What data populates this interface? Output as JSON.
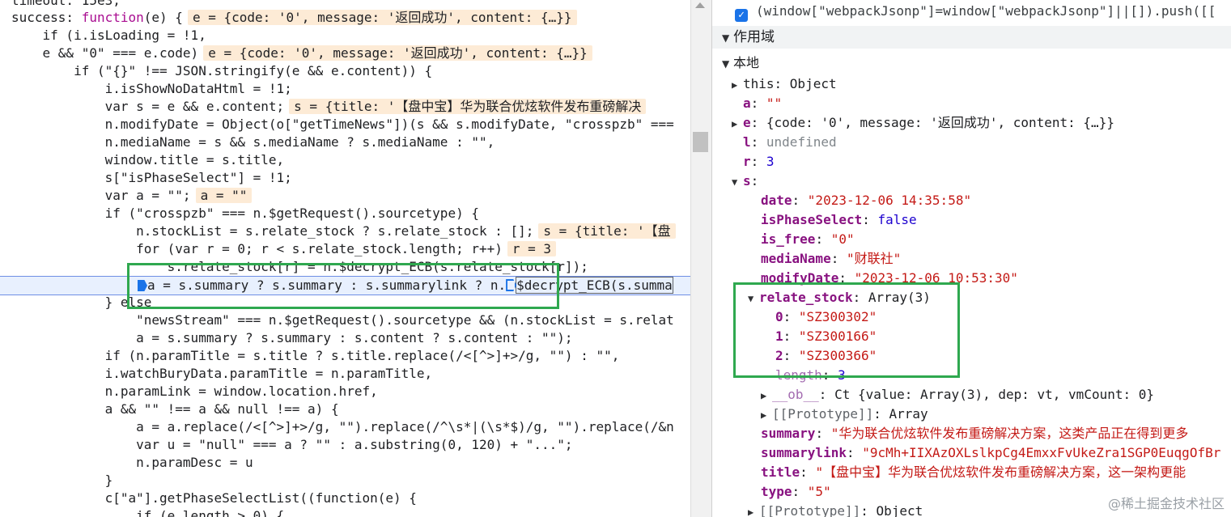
{
  "source": {
    "lines": [
      {
        "id": "l0",
        "text": "timeout: 15e3,"
      },
      {
        "id": "l1",
        "prefix": "success: ",
        "kw": "function",
        "rest": "(e) {",
        "annotation": "e = {code: '0', message: '返回成功', content: {…}}"
      },
      {
        "id": "l2",
        "text": "    if (i.isLoading = !1,"
      },
      {
        "id": "l3",
        "text": "    e && \"0\" === e.code)",
        "annotation": "e = {code: '0', message: '返回成功', content: {…}}"
      },
      {
        "id": "l4",
        "text": "        if (\"{}\" !== JSON.stringify(e && e.content)) {"
      },
      {
        "id": "l5",
        "text": "            i.isShowNoDataHtml = !1;"
      },
      {
        "id": "l6",
        "text": "            var s = e && e.content;",
        "annotation": "s = {title: '【盘中宝】华为联合优炫软件发布重磅解决"
      },
      {
        "id": "l7",
        "text": "            n.modifyDate = Object(o[\"getTimeNews\"])(s && s.modifyDate, \"crosspzb\" ==="
      },
      {
        "id": "l8",
        "text": "            n.mediaName = s && s.mediaName ? s.mediaName : \"\","
      },
      {
        "id": "l9",
        "text": "            window.title = s.title,"
      },
      {
        "id": "l10",
        "text": "            s[\"isPhaseSelect\"] = !1;"
      },
      {
        "id": "l11",
        "text": "            var a = \"\";",
        "annotation": "a = \"\""
      },
      {
        "id": "l12",
        "text": "            if (\"crosspzb\" === n.$getRequest().sourcetype) {"
      },
      {
        "id": "l13",
        "text": "                n.stockList = s.relate_stock ? s.relate_stock : [];",
        "annotation": "s = {title: '【盘"
      },
      {
        "id": "l14",
        "text": "                for (var r = 0; r < s.relate_stock.length; r++)",
        "annotation": "r = 3"
      },
      {
        "id": "l15",
        "text": "                    s.relate_stock[r] = n.$decrypt_ECB(s.relate_stock[r]);"
      },
      {
        "id": "l16",
        "text": "a = s.summary ? s.summary : s.summarylink ? n.",
        "tail": "$decrypt_ECB(s.summa"
      },
      {
        "id": "l17",
        "text": "            } else"
      },
      {
        "id": "l18",
        "text": "                \"newsStream\" === n.$getRequest().sourcetype && (n.stockList = s.relat"
      },
      {
        "id": "l19",
        "text": "                a = s.summary ? s.summary : s.content ? s.content : \"\");"
      },
      {
        "id": "l20",
        "text": "            if (n.paramTitle = s.title ? s.title.replace(/<[^>]+>/g, \"\") : \"\","
      },
      {
        "id": "l21",
        "text": "            i.watchBuryData.paramTitle = n.paramTitle,"
      },
      {
        "id": "l22",
        "text": "            n.paramLink = window.location.href,"
      },
      {
        "id": "l23",
        "text": "            a && \"\" !== a && null !== a) {"
      },
      {
        "id": "l24",
        "text": "                a = a.replace(/<[^>]+>/g, \"\").replace(/^\\s*|(\\s*$)/g, \"\").replace(/&n"
      },
      {
        "id": "l25",
        "text": "                var u = \"null\" === a ? \"\" : a.substring(0, 120) + \"...\";"
      },
      {
        "id": "l26",
        "text": "                n.paramDesc = u"
      },
      {
        "id": "l27",
        "text": "            }"
      },
      {
        "id": "l28",
        "text": "            c[\"a\"].getPhaseSelectList((function(e) {"
      },
      {
        "id": "l29",
        "text": "                if (e.length > 0) {"
      }
    ]
  },
  "scope": {
    "breakpoint_text": "(window[\"webpackJsonp\"]=window[\"webpackJsonp\"]||[]).push([[",
    "section_title": "作用域",
    "local_title": "本地",
    "vars": {
      "this": {
        "key": "this",
        "value": "Object"
      },
      "a": {
        "key": "a",
        "value": "\"\""
      },
      "e": {
        "key": "e",
        "value": "{code: '0', message: '返回成功', content: {…}}"
      },
      "l": {
        "key": "l",
        "value": "undefined"
      },
      "r": {
        "key": "r",
        "value": "3"
      },
      "s": {
        "key": "s",
        "value": ""
      }
    },
    "s_props": {
      "date": {
        "key": "date",
        "value": "\"2023-12-06 14:35:58\""
      },
      "isPhaseSelect": {
        "key": "isPhaseSelect",
        "value": "false"
      },
      "is_free": {
        "key": "is_free",
        "value": "\"0\""
      },
      "mediaName": {
        "key": "mediaName",
        "value": "\"财联社\""
      },
      "modifyDate": {
        "key": "modifyDate",
        "value": "\"2023-12-06 10:53:30\""
      },
      "relate_stock": {
        "key": "relate_stock",
        "value": "Array(3)"
      },
      "rs0": {
        "key": "0",
        "value": "\"SZ300302\""
      },
      "rs1": {
        "key": "1",
        "value": "\"SZ300166\""
      },
      "rs2": {
        "key": "2",
        "value": "\"SZ300366\""
      },
      "length": {
        "key": "length",
        "value": "3"
      },
      "ob": {
        "key": "__ob__",
        "value": "Ct {value: Array(3), dep: vt, vmCount: 0}"
      },
      "proto_arr": {
        "key": "[[Prototype]]",
        "value": "Array"
      },
      "summary": {
        "key": "summary",
        "value": "\"华为联合优炫软件发布重磅解决方案，这类产品正在得到更多"
      },
      "summarylink": {
        "key": "summarylink",
        "value": "\"9cMh+IIXAzOXLslkpCg4EmxxFvUkeZra1SGP0EuqgOfBr"
      },
      "title": {
        "key": "title",
        "value": "\"【盘中宝】华为联合优炫软件发布重磅解决方案，这一架构更能"
      },
      "type": {
        "key": "type",
        "value": "\"5\""
      },
      "proto_obj": {
        "key": "[[Prototype]]",
        "value": "Object"
      }
    }
  },
  "watermark": "@稀土掘金技术社区",
  "colors": {
    "highlight_box": "#2fa84f",
    "breakpoint": "#1a73e8",
    "annotation_bg": "#fdebd6"
  }
}
